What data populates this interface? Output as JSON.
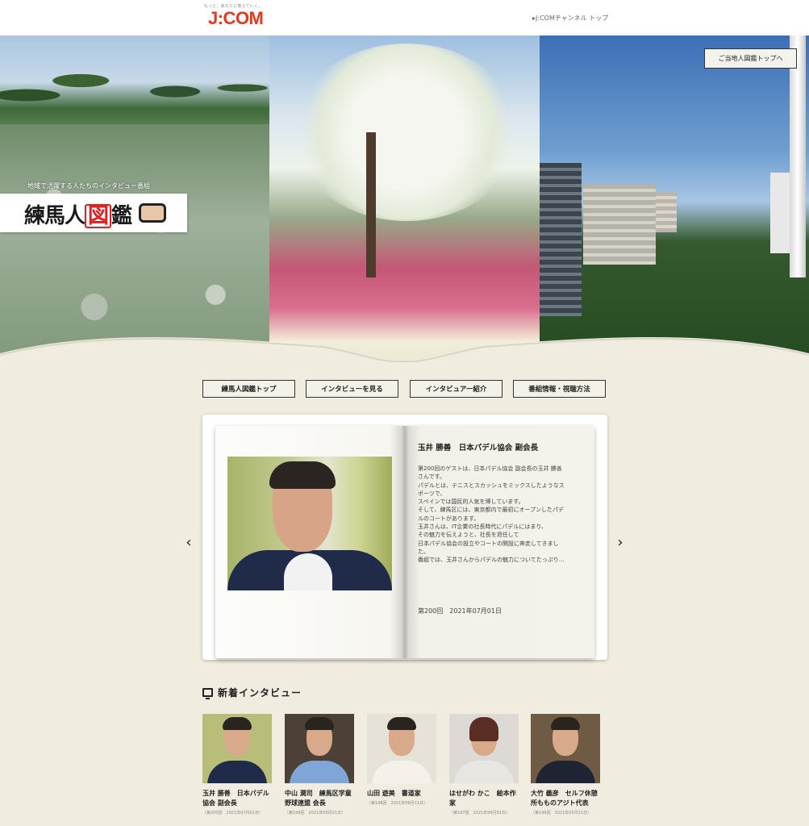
{
  "header": {
    "tagline": "もっと、あなたに答えていく。",
    "logo": "J:COM",
    "channel_link": "▸J:COMチャンネル トップ"
  },
  "hero": {
    "caption": "地域で活躍する人たちのインタビュー番組",
    "title_part1": "練馬人",
    "title_part2": "図",
    "title_part3": "鑑",
    "local_top_button": "ご当地人図鑑トップへ"
  },
  "nav": {
    "items": [
      "練馬人図鑑トップ",
      "インタビューを見る",
      "インタビュアー紹介",
      "番組情報・視聴方法"
    ]
  },
  "feature": {
    "guest_title": "玉井 勝善　日本パデル協会 副会長",
    "description": [
      "第200回のゲストは、日本パデル協会 副会長の玉井 勝善",
      "さんです。",
      "パデルとは、テニスとスカッシュをミックスしたようなス",
      "ポーツで、",
      "スペインでは国民的人気を博しています。",
      "そして、練馬区には、東京都内で最初にオープンしたパデ",
      "ルのコートがあります。",
      "玉井さんは、IT企業の社長時代にパデルにはまり、",
      "その魅力を伝えようと、社長を退任して",
      "日本パデル協会の設立やコートの開設に奔走してきまし",
      "た。",
      "番組では、玉井さんからパデルの魅力についてたっぷり…"
    ],
    "episode_date": "第200回　2021年07月01日",
    "prev_arrow": "‹",
    "next_arrow": "›"
  },
  "new_interviews": {
    "title": "新着インタビュー",
    "cards": [
      {
        "name": "玉井 勝善　日本パデル協会 副会長",
        "meta": "（第200回　2021年07月01日）",
        "bg": "#b9bd7a",
        "body": "#1f2b48"
      },
      {
        "name": "中山 潤司　練馬区学童野球連盟 会長",
        "meta": "（第199回　2021年06月21日）",
        "bg": "#4d4036",
        "body": "#7fa6d6"
      },
      {
        "name": "山田 遊美　書道家",
        "meta": "（第198回　2021年06月11日）",
        "bg": "#e7e2d8",
        "body": "#f4f1ea"
      },
      {
        "name": "はせがわ かこ　絵本作家",
        "meta": "（第197回　2021年06月01日）",
        "bg": "#ddd9d4",
        "body": "#e8e6e3"
      },
      {
        "name": "大竹 義彦　セルフ休憩所もものアジト代表",
        "meta": "（第196回　2021年05月21日）",
        "bg": "#6f5a44",
        "body": "#1e2433"
      }
    ]
  },
  "colors": {
    "logo_red": "#e8381c",
    "page_bg": "#f1ece0"
  }
}
